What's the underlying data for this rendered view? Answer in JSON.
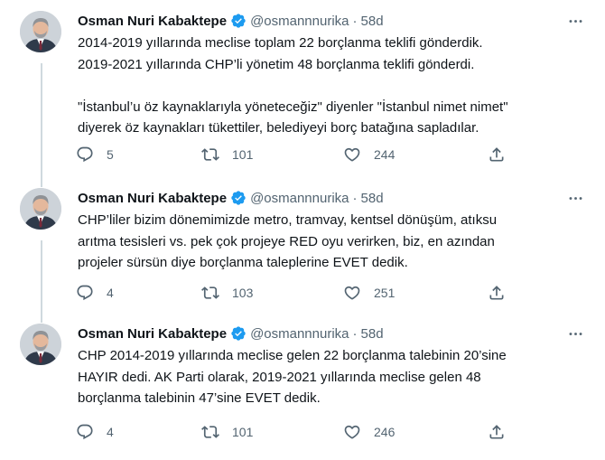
{
  "author": {
    "name": "Osman Nuri Kabaktepe",
    "handle": "@osmannnurika",
    "verified": true
  },
  "tweets": [
    {
      "time": "58d",
      "lines": [
        "2014-2019 yıllarında meclise toplam 22 borçlanma teklifi gönderdik.",
        "2019-2021 yıllarında CHP’li yönetim 48 borçlanma teklifi gönderdi.",
        "",
        "\"İstanbul’u öz kaynaklarıyla yöneteceğiz\" diyenler \"İstanbul nimet nimet\"",
        "diyerek öz kaynakları tükettiler, belediyeyi borç batağına sapladılar."
      ],
      "replies": "5",
      "retweets": "101",
      "likes": "244"
    },
    {
      "time": "58d",
      "lines": [
        "CHP’liler bizim dönemimizde metro, tramvay, kentsel dönüşüm, atıksu",
        "arıtma tesisleri vs. pek çok projeye RED oyu verirken, biz, en azından",
        "projeler sürsün diye borçlanma taleplerine EVET dedik."
      ],
      "replies": "4",
      "retweets": "103",
      "likes": "251"
    },
    {
      "time": "58d",
      "lines": [
        "CHP 2014-2019 yıllarında meclise gelen 22 borçlanma talebinin 20’sine",
        "HAYIR dedi. AK Parti olarak, 2019-2021 yıllarında meclise gelen 48",
        "borçlanma talebinin 47’sine EVET dedik."
      ],
      "replies": "4",
      "retweets": "101",
      "likes": "246"
    }
  ],
  "separator": "·",
  "icons": {
    "verified": "verified-badge-icon",
    "more": "more-options-icon",
    "reply": "reply-icon",
    "retweet": "retweet-icon",
    "like": "heart-icon",
    "share": "share-icon"
  },
  "colors": {
    "text": "#0f1419",
    "secondary": "#536471",
    "verified": "#1d9bf0",
    "thread_line": "#cfd9de"
  }
}
